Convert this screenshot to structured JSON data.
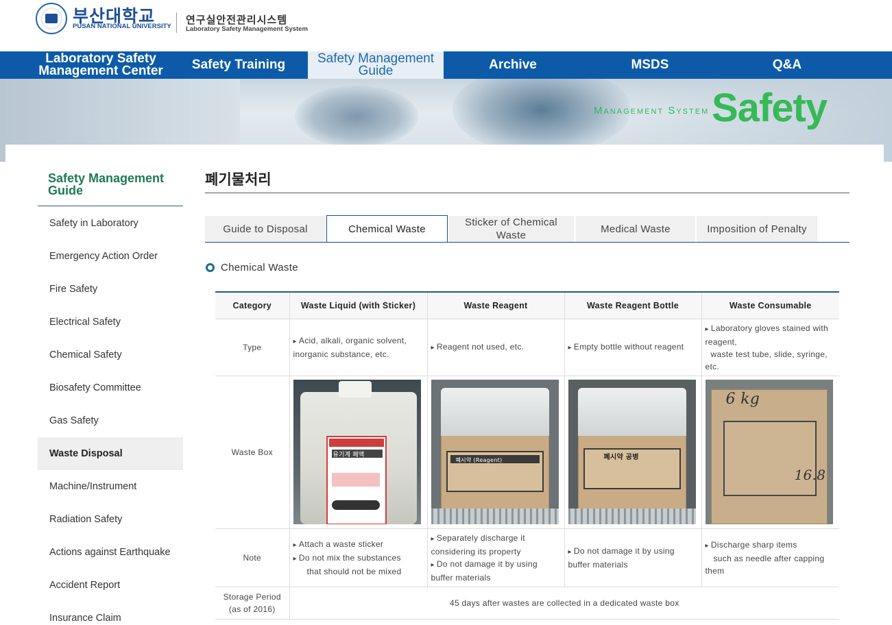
{
  "header": {
    "univ_ko": "부산대학교",
    "univ_en": "PUSAN NATIONAL UNIVERSITY",
    "system_ko": "연구실안전관리시스템",
    "system_en": "Laboratory Safety Management System"
  },
  "nav": [
    {
      "label": "Laboratory Safety\nManagement Center"
    },
    {
      "label": "Safety Training"
    },
    {
      "label": "Safety Management\nGuide"
    },
    {
      "label": "Archive"
    },
    {
      "label": "MSDS"
    },
    {
      "label": "Q&A"
    }
  ],
  "banner": {
    "sub": "Management System",
    "main": "Safety"
  },
  "sidebar": {
    "title": "Safety Management\nGuide",
    "items": [
      {
        "label": "Safety in Laboratory"
      },
      {
        "label": "Emergency Action Order"
      },
      {
        "label": "Fire Safety"
      },
      {
        "label": "Electrical Safety"
      },
      {
        "label": "Chemical Safety"
      },
      {
        "label": "Biosafety Committee"
      },
      {
        "label": "Gas Safety"
      },
      {
        "label": "Waste Disposal"
      },
      {
        "label": "Machine/Instrument"
      },
      {
        "label": "Radiation Safety"
      },
      {
        "label": "Actions against Earthquake"
      },
      {
        "label": "Accident Report"
      },
      {
        "label": "Insurance Claim"
      }
    ]
  },
  "page": {
    "title": "폐기물처리",
    "section": "Chemical Waste"
  },
  "tabs": [
    {
      "label": "Guide to Disposal"
    },
    {
      "label": "Chemical Waste"
    },
    {
      "label": "Sticker of Chemical\nWaste"
    },
    {
      "label": "Medical Waste"
    },
    {
      "label": "Imposition of Penalty"
    }
  ],
  "table": {
    "headers": [
      "Category",
      "Waste Liquid (with Sticker)",
      "Waste Reagent",
      "Waste Reagent Bottle",
      "Waste Consumable"
    ],
    "rows": {
      "type": {
        "label": "Type",
        "c1": "Acid, alkali, organic solvent, inorganic substance, etc.",
        "c2": "Reagent not used, etc.",
        "c3": "Empty bottle without reagent",
        "c4a": "Laboratory gloves stained with reagent,",
        "c4b": "waste test tube, slide, syringe, etc."
      },
      "box": {
        "label": "Waste Box",
        "img1_text": "유기계 폐액",
        "img2_text": "폐시약 (Reagent)",
        "img3_text": "폐시약 공병",
        "img4_text": "6 kg",
        "img4_text2": "16.8"
      },
      "note": {
        "label": "Note",
        "c1a": "Attach a waste sticker",
        "c1b": "Do not mix the substances",
        "c1c": "that should not be mixed",
        "c2a": "Separately discharge it considering its property",
        "c2b": "Do not damage it by using buffer materials",
        "c3": "Do not damage it by using buffer materials",
        "c4a": "Discharge sharp items",
        "c4b": "such as needle after capping them"
      },
      "storage": {
        "label": "Storage Period\n(as of 2016)",
        "value": "45 days after wastes are collected in a dedicated waste box"
      }
    }
  },
  "colors": {
    "nav_bg": "#0d5ba8",
    "accent_green": "#36b957",
    "sidebar_title": "#1e7a52"
  }
}
